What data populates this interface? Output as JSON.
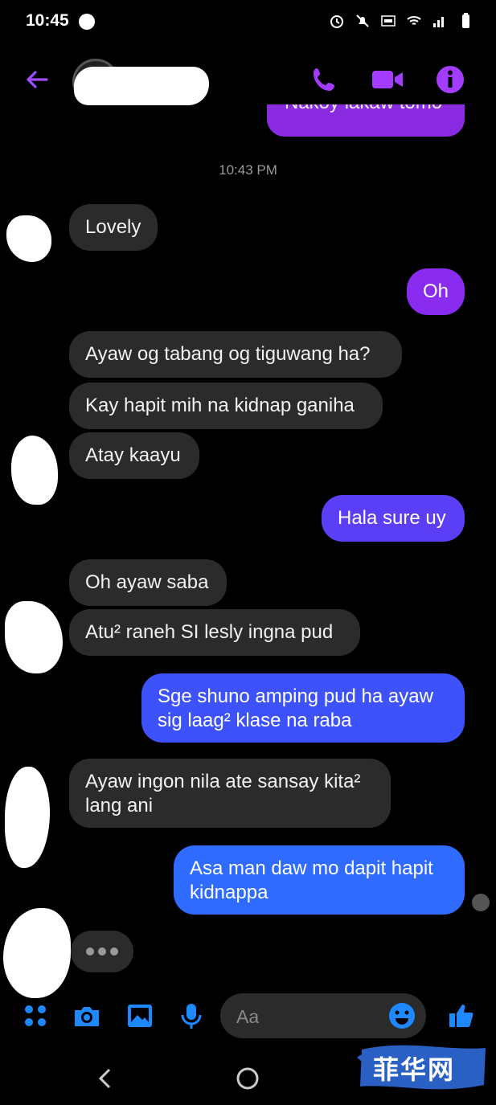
{
  "status_bar": {
    "time": "10:45"
  },
  "header": {
    "contact_name": ""
  },
  "colors": {
    "accent": "#8a2be2",
    "out_top": "#9b1ef2",
    "out_bottom": "#2f6bff",
    "incoming": "#2b2b2b",
    "composer_icon": "#1e88ff"
  },
  "chat": {
    "partial_top_message": "Nakoy lakaw tomo",
    "timestamp": "10:43 PM",
    "messages": [
      {
        "dir": "in",
        "text": "Lovely"
      },
      {
        "dir": "out",
        "text": "Oh"
      },
      {
        "dir": "in",
        "text": "Ayaw og tabang og tiguwang ha?"
      },
      {
        "dir": "in",
        "text": "Kay hapit mih na kidnap ganiha"
      },
      {
        "dir": "in",
        "text": "Atay kaayu"
      },
      {
        "dir": "out",
        "text": "Hala sure uy"
      },
      {
        "dir": "in",
        "text": "Oh ayaw saba"
      },
      {
        "dir": "in",
        "text": "Atu² raneh SI lesly ingna pud"
      },
      {
        "dir": "out",
        "text": "Sge shuno amping pud ha ayaw\nsig laag² klase na raba"
      },
      {
        "dir": "in",
        "text": "Ayaw ingon nila ate sansay kita²\nlang ani"
      },
      {
        "dir": "out",
        "text": "Asa man daw mo dapit hapit\nkidnappa"
      }
    ]
  },
  "composer": {
    "placeholder": "Aa"
  },
  "watermark": {
    "text": "菲华网"
  }
}
